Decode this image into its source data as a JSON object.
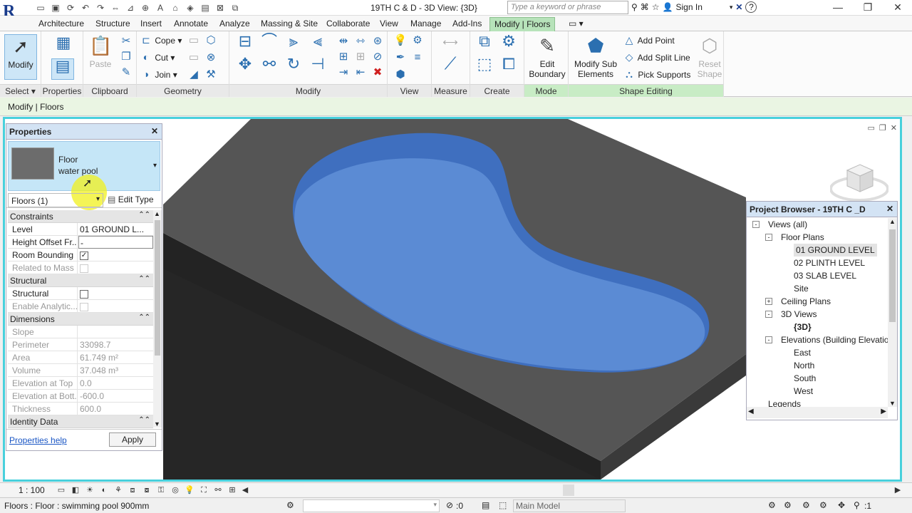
{
  "titlebar": {
    "logo": "R",
    "title": "19TH C & D - 3D View: {3D}",
    "search_placeholder": "Type a keyword or phrase",
    "sign_in": "Sign In",
    "help": "?"
  },
  "ribbon": {
    "tabs": [
      "Architecture",
      "Structure",
      "Insert",
      "Annotate",
      "Analyze",
      "Massing & Site",
      "Collaborate",
      "View",
      "Manage",
      "Add-Ins",
      "Modify | Floors"
    ],
    "active_tab": "Modify | Floors",
    "panels": {
      "select": "Select",
      "properties": "Properties",
      "clipboard": "Clipboard",
      "geometry": "Geometry",
      "modify": "Modify",
      "view": "View",
      "measure": "Measure",
      "create": "Create",
      "mode": "Mode",
      "shape_editing": "Shape Editing"
    },
    "buttons": {
      "modify": "Modify",
      "paste": "Paste",
      "cope": "Cope",
      "cut": "Cut",
      "join": "Join",
      "edit_boundary": "Edit Boundary",
      "modify_sub_elements": "Modify Sub Elements",
      "add_point": "Add Point",
      "add_split_line": "Add Split Line",
      "pick_supports": "Pick Supports",
      "reset_shape": "Reset Shape"
    }
  },
  "context_bar": {
    "text": "Modify | Floors"
  },
  "properties": {
    "header": "Properties",
    "type_family": "Floor",
    "type_name": "water pool",
    "instance_selector": "Floors (1)",
    "edit_type": "Edit Type",
    "groups": [
      {
        "name": "Constraints",
        "rows": [
          {
            "name": "Level",
            "value": "01 GROUND L..."
          },
          {
            "name": "Height Offset Fr...",
            "value": "-"
          },
          {
            "name": "Room Bounding",
            "value": "",
            "check": true
          },
          {
            "name": "Related to Mass",
            "value": "",
            "check": false,
            "readonly": true
          }
        ]
      },
      {
        "name": "Structural",
        "rows": [
          {
            "name": "Structural",
            "value": "",
            "check": false
          },
          {
            "name": "Enable Analytic...",
            "value": "",
            "check": false,
            "readonly": true
          }
        ]
      },
      {
        "name": "Dimensions",
        "rows": [
          {
            "name": "Slope",
            "value": "",
            "readonly": true
          },
          {
            "name": "Perimeter",
            "value": "33098.7",
            "readonly": true
          },
          {
            "name": "Area",
            "value": "61.749 m²",
            "readonly": true
          },
          {
            "name": "Volume",
            "value": "37.048 m³",
            "readonly": true
          },
          {
            "name": "Elevation at Top",
            "value": "0.0",
            "readonly": true
          },
          {
            "name": "Elevation at Bott...",
            "value": "-600.0",
            "readonly": true
          },
          {
            "name": "Thickness",
            "value": "600.0",
            "readonly": true
          }
        ]
      },
      {
        "name": "Identity Data",
        "rows": []
      }
    ],
    "help_link": "Properties help",
    "apply": "Apply"
  },
  "browser": {
    "header": "Project Browser - 19TH C _D",
    "tree": [
      {
        "label": "Views (all)",
        "level": 0,
        "expander": "-"
      },
      {
        "label": "Floor Plans",
        "level": 1,
        "expander": "-"
      },
      {
        "label": "01 GROUND LEVEL",
        "level": 2,
        "selected": true
      },
      {
        "label": "02 PLINTH LEVEL",
        "level": 2
      },
      {
        "label": "03 SLAB LEVEL",
        "level": 2
      },
      {
        "label": "Site",
        "level": 2
      },
      {
        "label": "Ceiling Plans",
        "level": 1,
        "expander": "+"
      },
      {
        "label": "3D Views",
        "level": 1,
        "expander": "-"
      },
      {
        "label": "{3D}",
        "level": 2,
        "bold": true
      },
      {
        "label": "Elevations (Building Elevation)",
        "level": 1,
        "expander": "-"
      },
      {
        "label": "East",
        "level": 2
      },
      {
        "label": "North",
        "level": 2
      },
      {
        "label": "South",
        "level": 2
      },
      {
        "label": "West",
        "level": 2
      },
      {
        "label": "Legends",
        "level": 0
      }
    ]
  },
  "view_bar": {
    "scale": "1 : 100"
  },
  "statusbar": {
    "text": "Floors : Floor : swimming pool 900mm",
    "selection_count": ":0",
    "design_option": "Main Model",
    "filter_count": ":1"
  },
  "colors": {
    "slab_top": "#555555",
    "slab_side": "#222222",
    "pool_water": "#5b8bd4",
    "accent_cyan": "#48d0dc",
    "ribbon_active": "#b7e3ba"
  }
}
